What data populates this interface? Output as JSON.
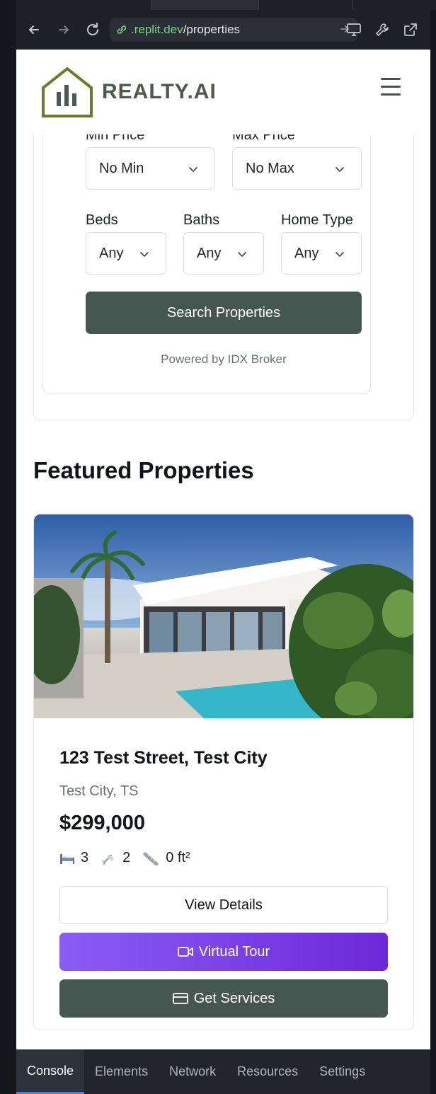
{
  "browser": {
    "url_domain": ".replit.dev",
    "url_path": "/properties",
    "back_icon": "arrow-left-icon",
    "forward_icon": "arrow-right-icon",
    "reload_icon": "reload-icon"
  },
  "header": {
    "logo_text": "REALTY.AI",
    "menu_icon": "hamburger-icon"
  },
  "search": {
    "min_price_label": "Min Price",
    "min_price_value": "No Min",
    "max_price_label": "Max Price",
    "max_price_value": "No Max",
    "beds_label": "Beds",
    "beds_value": "Any",
    "baths_label": "Baths",
    "baths_value": "Any",
    "home_type_label": "Home Type",
    "home_type_value": "Any",
    "search_button": "Search Properties",
    "powered_by": "Powered by IDX Broker"
  },
  "featured": {
    "title": "Featured Properties",
    "property": {
      "address": "123 Test Street, Test City",
      "location": "Test City, TS",
      "price": "$299,000",
      "beds": "3",
      "baths": "2",
      "area": "0 ft²",
      "view_details": "View Details",
      "virtual_tour": "Virtual Tour",
      "get_services": "Get Services"
    }
  },
  "devtools": {
    "tabs": [
      "Console",
      "Elements",
      "Network",
      "Resources",
      "Settings"
    ],
    "active_tab": "Console"
  },
  "colors": {
    "brand_green": "#465751",
    "logo_olive": "#6b7a2e",
    "tour_purple": "#7c3aed",
    "devtools_accent": "#3b82f6"
  }
}
